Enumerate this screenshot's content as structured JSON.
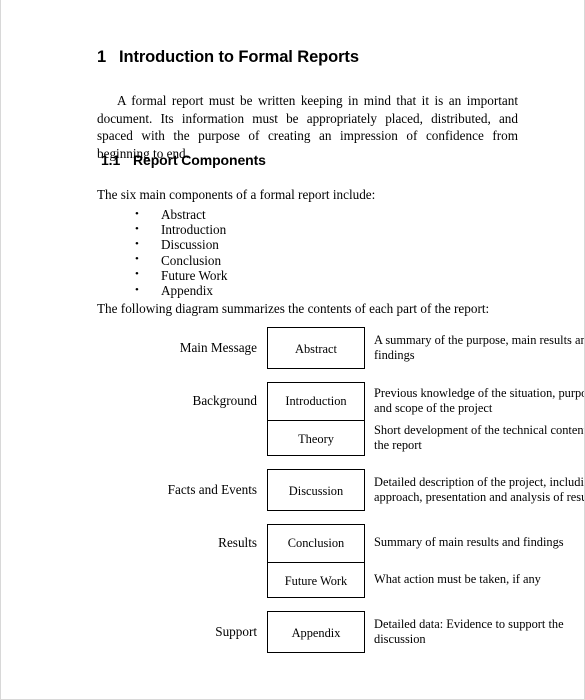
{
  "document": {
    "section1": {
      "number": "1",
      "title": "Introduction to Formal Reports",
      "paragraph": "A formal report must be written keeping in mind that it is an important document.  Its information must be appropriately placed, distributed, and spaced with the purpose of creating an impression of confidence from beginning to end."
    },
    "section11": {
      "number": "1.1",
      "title": "Report Components",
      "lead": "The six main components of a formal report include:",
      "components": [
        "Abstract",
        "Introduction",
        "Discussion",
        "Conclusion",
        "Future Work",
        "Appendix"
      ],
      "diagram_lead": "The following diagram summarizes the contents of each part of the report:"
    },
    "diagram": {
      "groups": [
        {
          "label": "Main Message",
          "rows": [
            {
              "box": "Abstract",
              "description": "A summary of the purpose, main results and findings"
            }
          ]
        },
        {
          "label": "Background",
          "rows": [
            {
              "box": "Introduction",
              "description": "Previous knowledge of the situation, purpose and scope of the project"
            },
            {
              "box": "Theory",
              "description": "Short development of the technical content of the report"
            }
          ]
        },
        {
          "label": "Facts and Events",
          "rows": [
            {
              "box": "Discussion",
              "description": "Detailed description of the project, including approach, presentation and analysis of results"
            }
          ]
        },
        {
          "label": "Results",
          "rows": [
            {
              "box": "Conclusion",
              "description": "Summary of main results and findings"
            },
            {
              "box": "Future Work",
              "description": "What action must be taken, if any"
            }
          ]
        },
        {
          "label": "Support",
          "rows": [
            {
              "box": "Appendix",
              "description": "Detailed data: Evidence to support the discussion"
            }
          ]
        }
      ]
    }
  }
}
